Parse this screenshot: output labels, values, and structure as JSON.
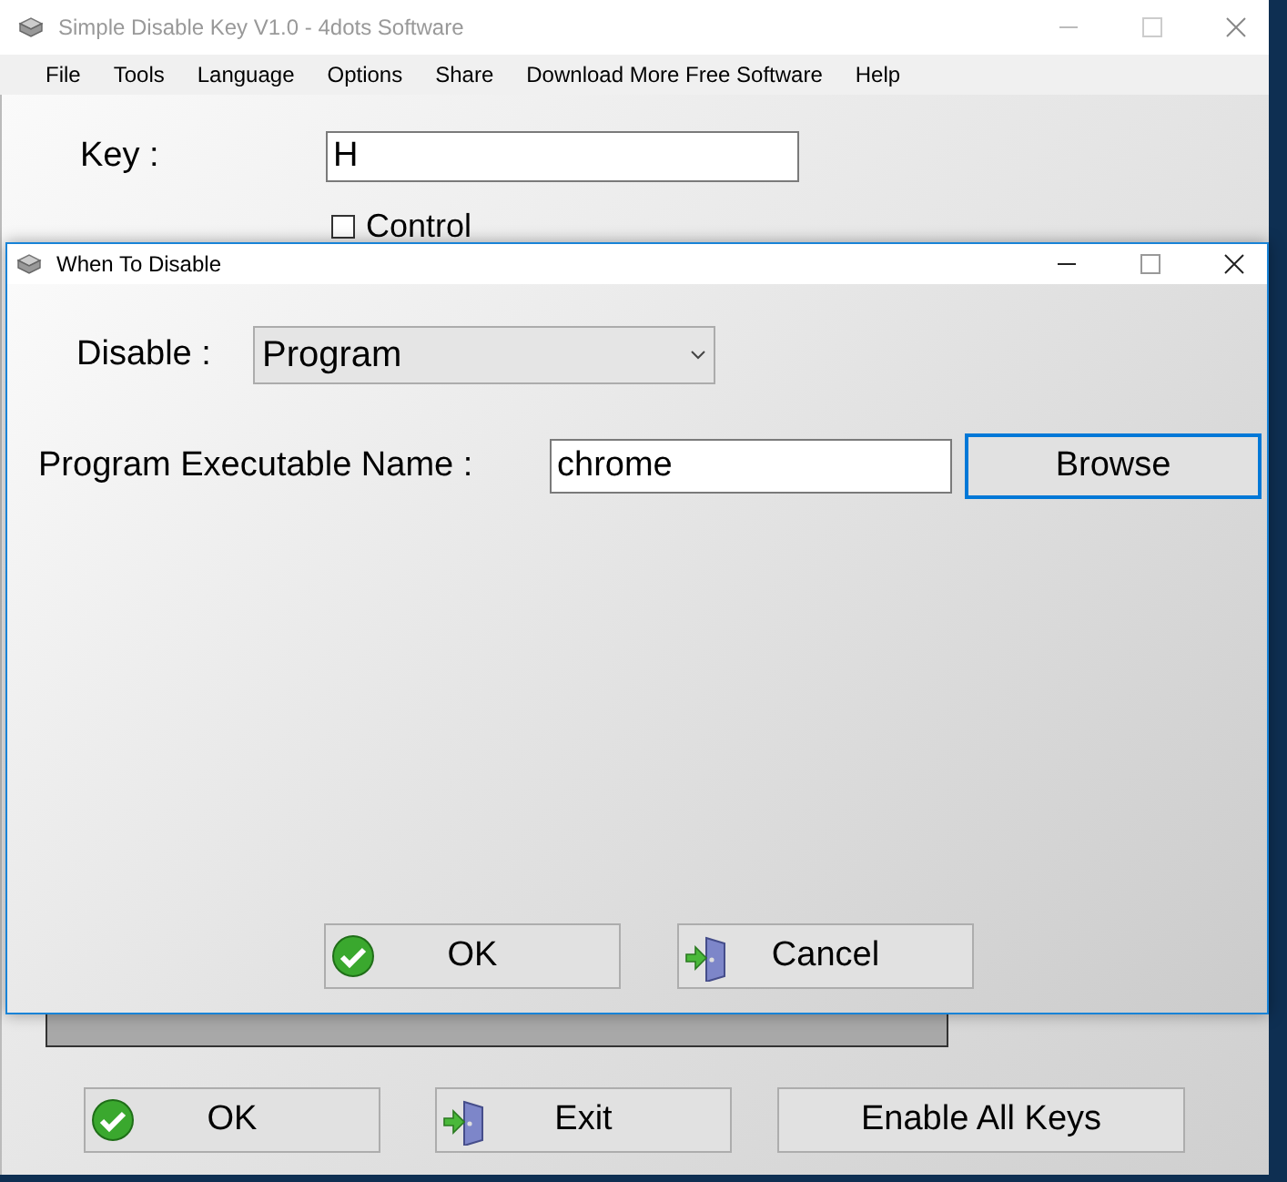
{
  "main_window": {
    "title": "Simple Disable Key V1.0 - 4dots Software",
    "menu": [
      "File",
      "Tools",
      "Language",
      "Options",
      "Share",
      "Download More Free Software",
      "Help"
    ],
    "key_label": "Key :",
    "key_value": "H",
    "control": {
      "label": "Control",
      "checked": false
    },
    "buttons": [
      {
        "label": "OK",
        "kind": "confirm"
      },
      {
        "label": "Exit",
        "kind": "exit"
      },
      {
        "label": "Enable All Keys",
        "kind": "plain"
      }
    ]
  },
  "dialog": {
    "title": "When To Disable",
    "disable_label": "Disable :",
    "disable_value": "Program",
    "program_label": "Program Executable Name :",
    "program_value": "chrome",
    "browse": {
      "label": "Browse",
      "focused": true
    },
    "buttons": [
      {
        "label": "OK",
        "kind": "confirm"
      },
      {
        "label": "Cancel",
        "kind": "exit"
      }
    ]
  }
}
